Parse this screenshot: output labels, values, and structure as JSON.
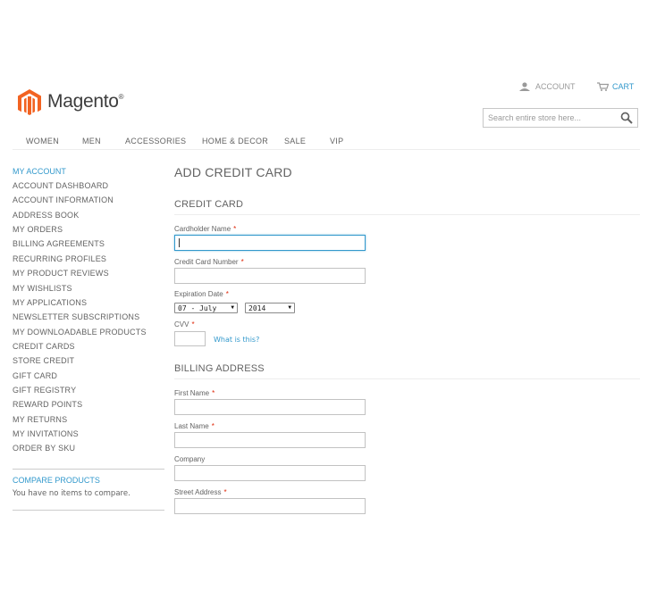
{
  "header": {
    "logo_text": "Magento",
    "logo_trademark": "®",
    "account_label": "ACCOUNT",
    "cart_label": "CART",
    "search_placeholder": "Search entire store here..."
  },
  "nav": {
    "items": [
      "WOMEN",
      "MEN",
      "ACCESSORIES",
      "HOME & DECOR",
      "SALE",
      "VIP"
    ]
  },
  "sidebar": {
    "title": "MY ACCOUNT",
    "items": [
      "ACCOUNT DASHBOARD",
      "ACCOUNT INFORMATION",
      "ADDRESS BOOK",
      "MY ORDERS",
      "BILLING AGREEMENTS",
      "RECURRING PROFILES",
      "MY PRODUCT REVIEWS",
      "MY WISHLISTS",
      "MY APPLICATIONS",
      "NEWSLETTER SUBSCRIPTIONS",
      "MY DOWNLOADABLE PRODUCTS",
      "CREDIT CARDS",
      "STORE CREDIT",
      "GIFT CARD",
      "GIFT REGISTRY",
      "REWARD POINTS",
      "MY RETURNS",
      "MY INVITATIONS",
      "ORDER BY SKU"
    ],
    "compare_title": "COMPARE PRODUCTS",
    "compare_empty": "You have no items to compare."
  },
  "main": {
    "page_title": "ADD CREDIT CARD",
    "credit_card_section": "CREDIT CARD",
    "cardholder_label": "Cardholder Name",
    "card_number_label": "Credit Card Number",
    "expiration_label": "Expiration Date",
    "exp_month_value": "07 - July",
    "exp_year_value": "2014",
    "cvv_label": "CVV",
    "cvv_help": "What is this?",
    "billing_section": "BILLING ADDRESS",
    "first_name_label": "First Name",
    "last_name_label": "Last Name",
    "company_label": "Company",
    "street_label": "Street Address",
    "required_mark": "*"
  },
  "colors": {
    "accent": "#3399cc",
    "required": "#df280a",
    "logo_orange": "#f26322",
    "text": "#636363"
  }
}
